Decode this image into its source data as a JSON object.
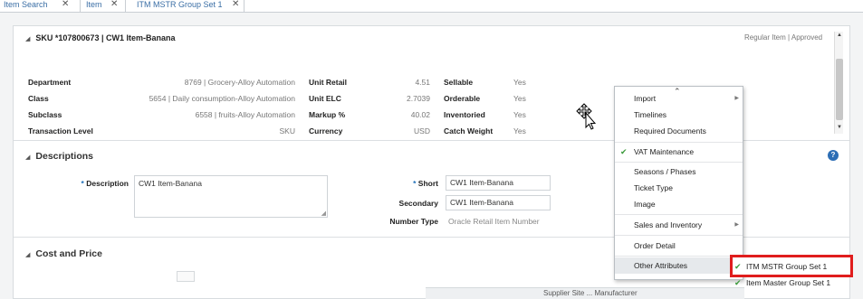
{
  "tabs": [
    {
      "label": "Item Search"
    },
    {
      "label": "Item"
    },
    {
      "label": "ITM MSTR Group Set 1"
    }
  ],
  "header": {
    "sku_title": "SKU *107800673 | CW1 Item-Banana",
    "status": "Regular Item  |  Approved"
  },
  "attributes": {
    "col1": [
      {
        "label": "Department",
        "value": "8769 | Grocery-Alloy Automation"
      },
      {
        "label": "Class",
        "value": "5654 | Daily consumption-Alloy Automation"
      },
      {
        "label": "Subclass",
        "value": "6558 | fruits-Alloy Automation"
      },
      {
        "label": "Transaction Level",
        "value": "SKU"
      }
    ],
    "col2": [
      {
        "label": "Unit Retail",
        "value": "4.51"
      },
      {
        "label": "Unit ELC",
        "value": "2.7039"
      },
      {
        "label": "Markup %",
        "value": "40.02"
      },
      {
        "label": "Currency",
        "value": "USD"
      }
    ],
    "col3": [
      {
        "label": "Sellable",
        "value": "Yes"
      },
      {
        "label": "Orderable",
        "value": "Yes"
      },
      {
        "label": "Inventoried",
        "value": "Yes"
      },
      {
        "label": "Catch Weight",
        "value": "Yes"
      }
    ]
  },
  "descriptions": {
    "section_title": "Descriptions",
    "description_label": "Description",
    "description_value": "CW1 Item-Banana",
    "short_label": "Short",
    "short_value": "CW1 Item-Banana",
    "secondary_label": "Secondary",
    "secondary_value": "CW1 Item-Banana",
    "number_type_label": "Number Type",
    "number_type_value": "Oracle Retail Item Number",
    "required_marker": "*"
  },
  "cost_price": {
    "section_title": "Cost and Price"
  },
  "bottom_strip_text": "Supplier Site  ...  Manufacturer",
  "menu": {
    "items": [
      {
        "label": "Import",
        "submenu": true,
        "checked": false
      },
      {
        "label": "Timelines",
        "submenu": false,
        "checked": false
      },
      {
        "label": "Required Documents",
        "submenu": false,
        "checked": false
      },
      {
        "label": "VAT Maintenance",
        "submenu": false,
        "checked": true
      },
      {
        "label": "Seasons / Phases",
        "submenu": false,
        "checked": false
      },
      {
        "label": "Ticket Type",
        "submenu": false,
        "checked": false
      },
      {
        "label": "Image",
        "submenu": false,
        "checked": false
      },
      {
        "label": "Sales and Inventory",
        "submenu": true,
        "checked": false
      },
      {
        "label": "Order Detail",
        "submenu": false,
        "checked": false
      },
      {
        "label": "Other Attributes",
        "submenu": true,
        "checked": false
      }
    ]
  },
  "submenu": {
    "items": [
      {
        "label": "ITM MSTR Group Set 1",
        "checked": true
      },
      {
        "label": "Item Master Group Set 1",
        "checked": true
      }
    ]
  },
  "colors": {
    "accent": "#3a6ea5",
    "highlight_border": "#e01d1d",
    "check": "#3b9a3b"
  }
}
